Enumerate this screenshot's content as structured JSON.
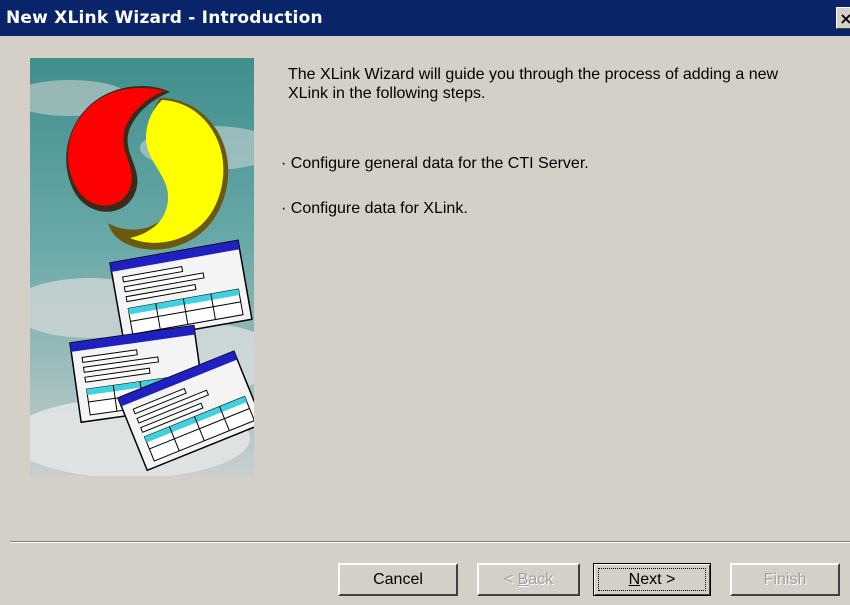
{
  "window": {
    "title": "New XLink Wizard - Introduction",
    "close_glyph": "×"
  },
  "main": {
    "intro": "The XLink Wizard will guide you through the process of adding a new XLink in the following steps.",
    "steps": [
      "· Configure general data for the CTI Server.",
      "· Configure data for XLink."
    ]
  },
  "illustration": {
    "icon": "wizard-illustration"
  },
  "buttons": {
    "cancel": "Cancel",
    "back_mnemonic": "B",
    "back_prefix": "< ",
    "back_rest": "ack",
    "next_mnemonic": "N",
    "next_rest": "ext >",
    "finish": "Finish"
  },
  "colors": {
    "titlebar": "#0a246a",
    "dialog_bg": "#d4d0c8",
    "logo_red": "#ff0000",
    "logo_yellow": "#ffff00",
    "sky_teal": "#4d9a98",
    "form_blue": "#2020c0",
    "form_cyan": "#40d0e0"
  }
}
